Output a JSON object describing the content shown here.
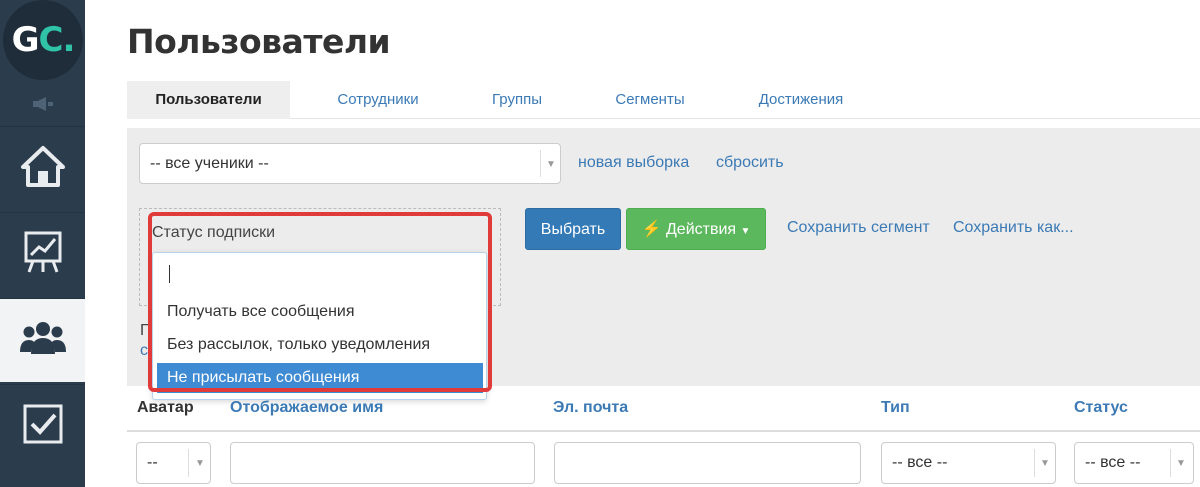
{
  "logo": {
    "g": "G",
    "c": "C."
  },
  "sidebar": {
    "items": [
      {
        "icon": "home-icon"
      },
      {
        "icon": "chart-icon"
      },
      {
        "icon": "users-icon"
      },
      {
        "icon": "checkbox-icon"
      }
    ]
  },
  "page_title": "Пользователи",
  "tabs": [
    {
      "label": "Пользователи",
      "active": true
    },
    {
      "label": "Сотрудники"
    },
    {
      "label": "Группы"
    },
    {
      "label": "Сегменты"
    },
    {
      "label": "Достижения"
    }
  ],
  "filter": {
    "segment_select": "-- все ученики --",
    "new_selection_link": "новая выборка",
    "reset_link": "сбросить",
    "status_label": "Статус подписки",
    "search_value": "",
    "options": [
      "Получать все сообщения",
      "Без рассылок, только уведомления",
      "Не присылать сообщения"
    ],
    "selected_option": "Не присылать сообщения",
    "hidden_text_1": "П",
    "hidden_text_2": "с",
    "select_button": "Выбрать",
    "actions_button": "Действия",
    "save_segment_link": "Сохранить сегмент",
    "save_as_link": "Сохранить как..."
  },
  "table": {
    "columns": [
      "Аватар",
      "Отображаемое имя",
      "Эл. почта",
      "Тип",
      "Статус"
    ],
    "filters": {
      "avatar": "--",
      "type": "-- все --",
      "status": "-- все --"
    }
  },
  "colors": {
    "sidebar": "#2b3c4c",
    "accent": "#3b7ab5",
    "primary_button": "#337ab7",
    "success_button": "#5cb85c",
    "highlight": "#e03a3a",
    "selected_option": "#3e8bd4"
  }
}
